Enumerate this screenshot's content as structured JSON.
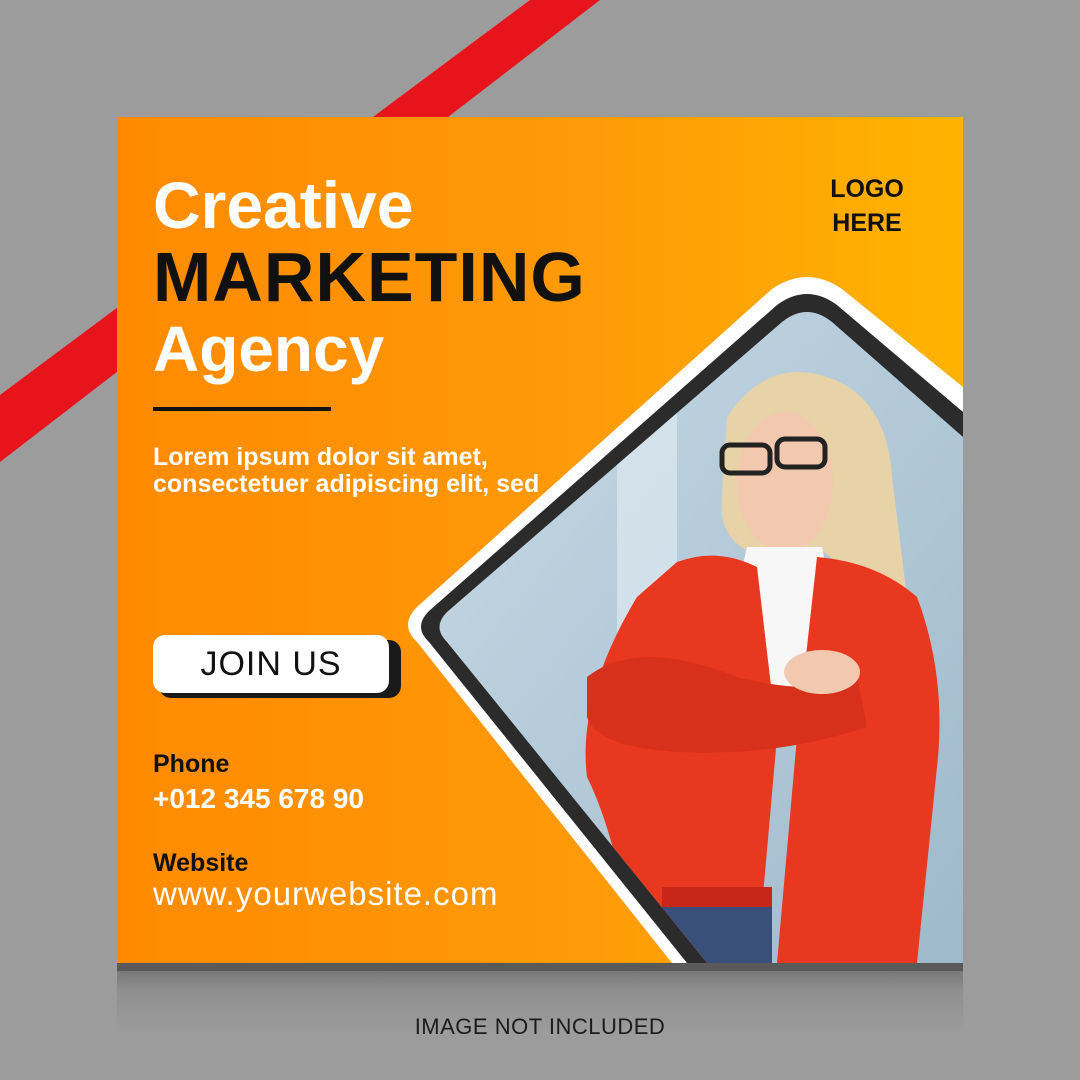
{
  "headline": {
    "line1": "Creative",
    "line2": "MARKETING",
    "line3": "Agency"
  },
  "body": "Lorem ipsum dolor sit amet, consectetuer adipiscing elit, sed",
  "cta_label": "JOIN US",
  "contact": {
    "phone_label": "Phone",
    "phone_value": "+012 345 678 90",
    "website_label": "Website",
    "website_value": "www.yourwebsite.com"
  },
  "logo": {
    "line1": "LOGO",
    "line2": "HERE"
  },
  "caption": "IMAGE NOT INCLUDED",
  "colors": {
    "background": "#9c9c9c",
    "stripe": "#e8141c",
    "card_orange": "#ff8a00",
    "card_yellow": "#ffb300",
    "frame_dark": "#2b2b2b",
    "jacket_red": "#e8381f"
  },
  "icons": [
    "photo-placeholder-woman"
  ]
}
